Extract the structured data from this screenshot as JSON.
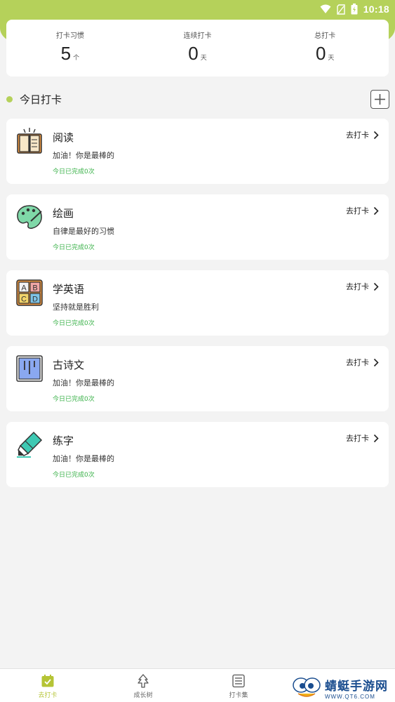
{
  "status_bar": {
    "time": "10:18"
  },
  "stats": [
    {
      "label": "打卡习惯",
      "value": "5",
      "unit": "个"
    },
    {
      "label": "连续打卡",
      "value": "0",
      "unit": "天"
    },
    {
      "label": "总打卡",
      "value": "0",
      "unit": "天"
    }
  ],
  "section": {
    "title": "今日打卡"
  },
  "habits": [
    {
      "name": "阅读",
      "motto": "加油！你是最棒的",
      "count_text": "今日已完成0次",
      "action": "去打卡",
      "icon": "book-icon"
    },
    {
      "name": "绘画",
      "motto": "自律是最好的习惯",
      "count_text": "今日已完成0次",
      "action": "去打卡",
      "icon": "palette-icon"
    },
    {
      "name": "学英语",
      "motto": "坚持就是胜利",
      "count_text": "今日已完成0次",
      "action": "去打卡",
      "icon": "abcd-blocks-icon"
    },
    {
      "name": "古诗文",
      "motto": "加油！你是最棒的",
      "count_text": "今日已完成0次",
      "action": "去打卡",
      "icon": "scroll-icon"
    },
    {
      "name": "练字",
      "motto": "加油！你是最棒的",
      "count_text": "今日已完成0次",
      "action": "去打卡",
      "icon": "marker-pen-icon"
    }
  ],
  "nav": [
    {
      "label": "去打卡",
      "icon": "calendar-check-icon",
      "active": true
    },
    {
      "label": "成长树",
      "icon": "tree-icon",
      "active": false
    },
    {
      "label": "打卡集",
      "icon": "list-icon",
      "active": false
    }
  ],
  "watermark": {
    "cn": "蜻蜓手游网",
    "en": "WWW.QT6.COM"
  },
  "colors": {
    "accent": "#b5d15a",
    "done_text": "#3bb24a",
    "nav_active": "#b5c435"
  }
}
